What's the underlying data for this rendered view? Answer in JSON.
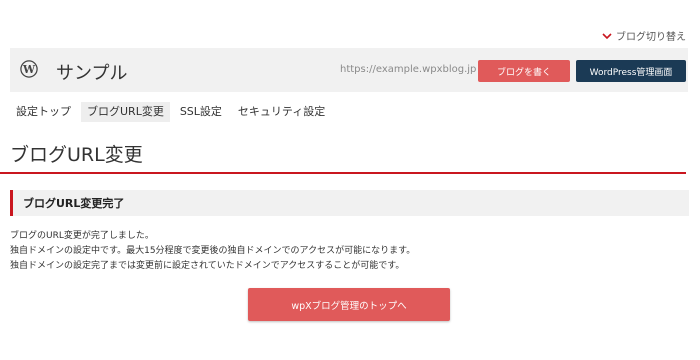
{
  "header": {
    "blog_switch_label": "ブログ切り替え",
    "site_name": "サンプル",
    "site_url": "https://example.wpxblog.jp",
    "write_button": "ブログを書く",
    "wp_admin_button": "WordPress管理画面"
  },
  "tabs": [
    {
      "label": "設定トップ"
    },
    {
      "label": "ブログURL変更",
      "active": true
    },
    {
      "label": "SSL設定"
    },
    {
      "label": "セキュリティ設定"
    }
  ],
  "main": {
    "page_title": "ブログURL変更",
    "section_title": "ブログURL変更完了",
    "messages": [
      "ブログのURL変更が完了しました。",
      "独自ドメインの設定中です。最大15分程度で変更後の独自ドメインでのアクセスが可能になります。",
      "独自ドメインの設定完了までは変更前に設定されていたドメインでアクセスすることが可能です。"
    ],
    "top_button": "wpXブログ管理のトップへ"
  },
  "colors": {
    "accent_red": "#c9161f",
    "button_red": "#e05a5a",
    "button_navy": "#1b3a55"
  },
  "icons": {
    "blog_switch": "chevron-down-icon",
    "logo": "wordpress-icon",
    "url": "external-link-icon"
  }
}
